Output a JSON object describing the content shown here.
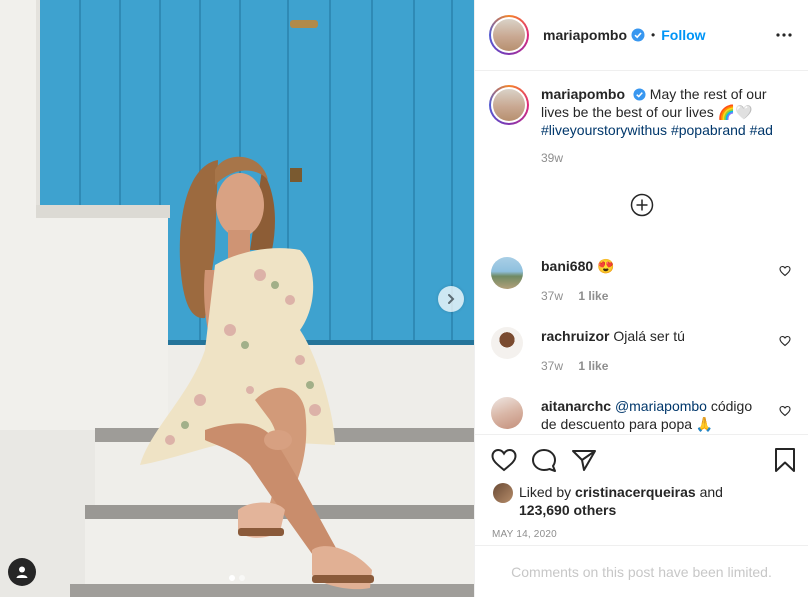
{
  "post": {
    "username": "mariapombo",
    "follow_label": "Follow",
    "separator": "•",
    "caption": {
      "username": "mariapombo",
      "text": "May the rest of our lives be the best of our lives 🌈🤍",
      "hashtags": [
        "#liveyourstorywithus",
        "#popabrand",
        "#ad"
      ],
      "time": "39w"
    },
    "comments": [
      {
        "username": "bani680",
        "text": "😍",
        "time": "37w",
        "likes": "1 like"
      },
      {
        "username": "rachruizor",
        "text": "Ojalá ser tú",
        "time": "37w",
        "likes": "1 like"
      },
      {
        "username": "aitanarchc",
        "mention": "@mariapombo",
        "text": "código de descuento para popa 🙏"
      }
    ],
    "liked_by": {
      "prefix": "Liked by",
      "user": "cristinacerqueiras",
      "and": "and",
      "others": "123,690 others"
    },
    "date": "MAY 14, 2020",
    "comments_limited": "Comments on this post have been limited.",
    "carousel": {
      "count": 2,
      "active": 0
    }
  },
  "icons": {
    "verified": "verified-badge-icon",
    "more": "more-options-icon",
    "load_more": "plus-circle-icon",
    "like": "heart-icon",
    "comment": "comment-icon",
    "share": "share-icon",
    "save": "bookmark-icon",
    "next": "chevron-right-icon",
    "tag": "user-tag-icon"
  },
  "colors": {
    "link": "#0095f6",
    "hashtag": "#00376b",
    "muted": "#8e8e8e",
    "door": "#3fa3cf"
  }
}
